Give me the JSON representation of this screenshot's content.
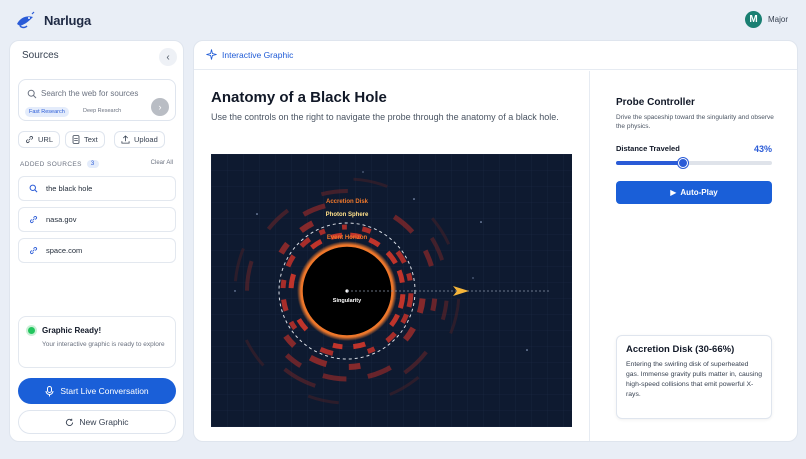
{
  "app": {
    "name": "Narluga"
  },
  "user": {
    "initial": "M",
    "name": "Major",
    "avatar_color": "#1a7f72"
  },
  "sidebar": {
    "title": "Sources",
    "search": {
      "placeholder": "Search the web for sources",
      "modes": [
        "Fast Research",
        "Deep Research"
      ],
      "active_mode": "Fast Research"
    },
    "add_buttons": [
      "URL",
      "Text",
      "Upload"
    ],
    "added_label": "ADDED SOURCES",
    "added_count": "3",
    "clear_label": "Clear All",
    "sources": [
      {
        "label": "the black hole",
        "icon": "search-icon"
      },
      {
        "label": "nasa.gov",
        "icon": "link-icon"
      },
      {
        "label": "space.com",
        "icon": "link-icon"
      }
    ],
    "status": {
      "title": "Graphic Ready!",
      "description": "Your interactive graphic is ready to explore"
    },
    "live_button": "Start Live Conversation",
    "new_button": "New Graphic"
  },
  "main": {
    "header": "Interactive Graphic",
    "title": "Anatomy of a Black Hole",
    "subtitle": "Use the controls on the right to navigate the probe through the anatomy of a black hole.",
    "graphic": {
      "labels": {
        "accretion": "Accretion Disk",
        "photon": "Photon Sphere",
        "horizon": "Event Horizon",
        "singularity": "Singularity"
      }
    }
  },
  "controller": {
    "title": "Probe Controller",
    "description": "Drive the spaceship toward the singularity and observe the physics.",
    "distance_label": "Distance Traveled",
    "distance_value": "43%",
    "distance_fraction": 0.43,
    "autoplay_label": "Auto-Play"
  },
  "info": {
    "title": "Accretion Disk (30-66%)",
    "body": "Entering the swirling disk of superheated gas. Immense gravity pulls matter in, causing high-speed collisions that emit powerful X-rays."
  },
  "colors": {
    "accent": "#1a5fd8",
    "space": "#0e1a30",
    "disk": "#e0412f",
    "horizon": "#f0782b"
  }
}
